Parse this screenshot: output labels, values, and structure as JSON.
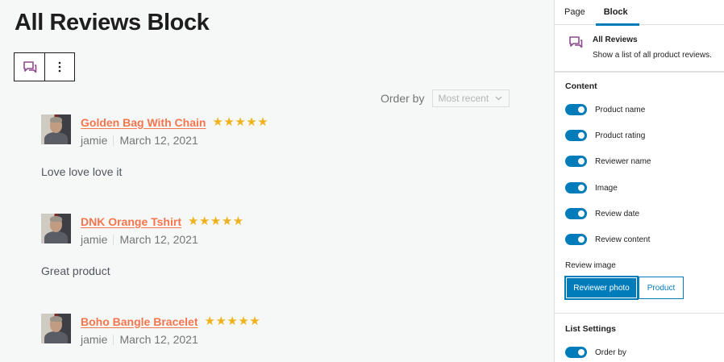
{
  "editor": {
    "title": "All Reviews Block",
    "order_by_label": "Order by",
    "order_by_value": "Most recent",
    "reviews": [
      {
        "product": "Golden Bag With Chain",
        "rating": 5,
        "author": "jamie",
        "date": "March 12, 2021",
        "content": "Love love love it"
      },
      {
        "product": "DNK Orange Tshirt",
        "rating": 5,
        "author": "jamie",
        "date": "March 12, 2021",
        "content": "Great product"
      },
      {
        "product": "Boho Bangle Bracelet",
        "rating": 5,
        "author": "jamie",
        "date": "March 12, 2021",
        "content": ""
      }
    ]
  },
  "sidebar": {
    "tabs": [
      {
        "label": "Page"
      },
      {
        "label": "Block"
      }
    ],
    "active_tab": "Block",
    "block_card": {
      "title": "All Reviews",
      "description": "Show a list of all product reviews."
    },
    "content_heading": "Content",
    "toggles": [
      {
        "label": "Product name",
        "on": true
      },
      {
        "label": "Product rating",
        "on": true
      },
      {
        "label": "Reviewer name",
        "on": true
      },
      {
        "label": "Image",
        "on": true
      },
      {
        "label": "Review date",
        "on": true
      },
      {
        "label": "Review content",
        "on": true
      }
    ],
    "review_image_label": "Review image",
    "review_image_options": [
      {
        "label": "Reviewer photo",
        "selected": true
      },
      {
        "label": "Product",
        "selected": false
      }
    ],
    "list_settings_heading": "List Settings",
    "list_toggles": [
      {
        "label": "Order by",
        "on": true
      }
    ]
  },
  "colors": {
    "accent": "#007cba",
    "product_link": "#f5764d",
    "star": "#f0b21b",
    "block_icon": "#8e4a8f"
  }
}
